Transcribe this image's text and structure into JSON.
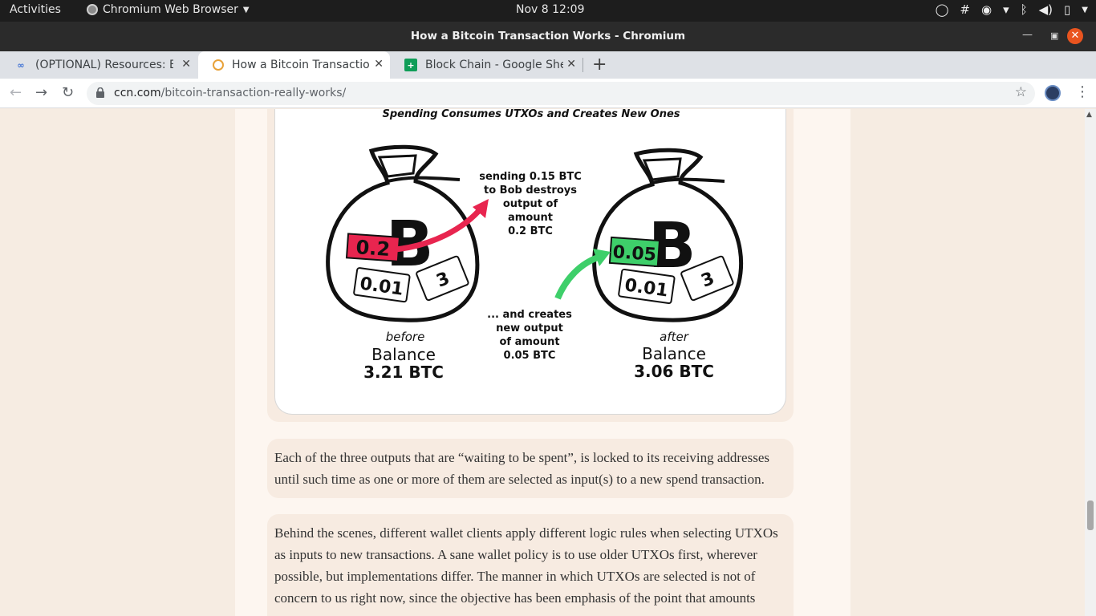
{
  "system_bar": {
    "activities": "Activities",
    "app_name": "Chromium Web Browser",
    "clock": "Nov 8  12:09"
  },
  "window": {
    "title": "How a Bitcoin Transaction Works - Chromium"
  },
  "tabs": [
    {
      "label": "(OPTIONAL) Resources: B"
    },
    {
      "label": "How a Bitcoin Transaction"
    },
    {
      "label": "Block Chain - Google Shee"
    }
  ],
  "address_bar": {
    "host": "ccn.com",
    "path": "/bitcoin-transaction-really-works/"
  },
  "figure": {
    "title": "Spending Consumes UTXOs and Creates New Ones",
    "before": {
      "caption": "before",
      "balance_label": "Balance",
      "balance_value": "3.21 BTC",
      "tags": [
        "0.2",
        "0.01",
        "3"
      ]
    },
    "after": {
      "caption": "after",
      "balance_label": "Balance",
      "balance_value": "3.06 BTC",
      "tags": [
        "0.05",
        "0.01",
        "3"
      ]
    },
    "top_note": [
      "sending 0.15 BTC",
      "to Bob destroys",
      "output of",
      "amount",
      "0.2 BTC"
    ],
    "bottom_note": [
      "... and creates",
      "new output",
      "of amount",
      "0.05 BTC"
    ],
    "colors": {
      "red": "#e8254f",
      "green": "#3ecf6a"
    }
  },
  "article": {
    "paragraph1": "Each of the three outputs that are “waiting to be spent”, is locked to its receiving addresses until such time as one or more of them are selected as input(s) to a new spend transaction.",
    "paragraph2": "Behind the scenes, different wallet clients apply different logic rules when selecting UTXOs as inputs to new transactions. A sane wallet policy is to use older UTXOs first, wherever possible, but implementations differ. The manner in which UTXOs are selected is not of concern to us right now, since the objective has been emphasis of the point that amounts"
  }
}
